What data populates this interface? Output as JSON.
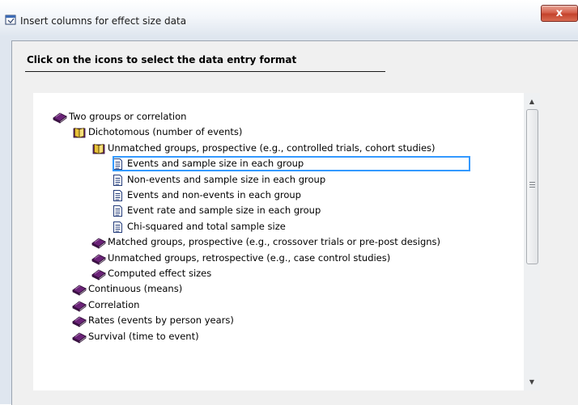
{
  "window": {
    "title": "Insert columns for effect size data",
    "close_glyph": "x"
  },
  "dialog": {
    "instruction": "Click on the icons to select the data entry format"
  },
  "tree": {
    "items": [
      {
        "label": "Two groups or correlation",
        "icon": "closed-book-icon",
        "level": 0
      },
      {
        "label": "Dichotomous (number of events)",
        "icon": "open-book-icon",
        "level": 1
      },
      {
        "label": "Unmatched groups, prospective (e.g., controlled trials, cohort studies)",
        "icon": "open-book-icon",
        "level": 2
      },
      {
        "label": "Events and sample size in each group",
        "icon": "document-icon",
        "level": 3,
        "selected": true
      },
      {
        "label": "Non-events and sample size in each group",
        "icon": "document-icon",
        "level": 3
      },
      {
        "label": "Events and non-events in each group",
        "icon": "document-icon",
        "level": 3
      },
      {
        "label": "Event rate and sample size in each group",
        "icon": "document-icon",
        "level": 3
      },
      {
        "label": "Chi-squared and total sample size",
        "icon": "document-icon",
        "level": 3
      },
      {
        "label": "Matched groups, prospective (e.g., crossover trials or pre-post designs)",
        "icon": "closed-book-icon",
        "level": 2
      },
      {
        "label": "Unmatched groups, retrospective (e.g., case control studies)",
        "icon": "closed-book-icon",
        "level": 2
      },
      {
        "label": "Computed effect sizes",
        "icon": "closed-book-icon",
        "level": 2
      },
      {
        "label": "Continuous (means)",
        "icon": "closed-book-icon",
        "level": 1
      },
      {
        "label": "Correlation",
        "icon": "closed-book-icon",
        "level": 1
      },
      {
        "label": "Rates (events by person years)",
        "icon": "closed-book-icon",
        "level": 1
      },
      {
        "label": "Survival (time to event)",
        "icon": "closed-book-icon",
        "level": 1
      }
    ]
  },
  "colors": {
    "book_purple": "#6b2378",
    "book_yellow": "#e8c13a",
    "selection_border": "#3399ff",
    "close_red": "#c4432c"
  }
}
